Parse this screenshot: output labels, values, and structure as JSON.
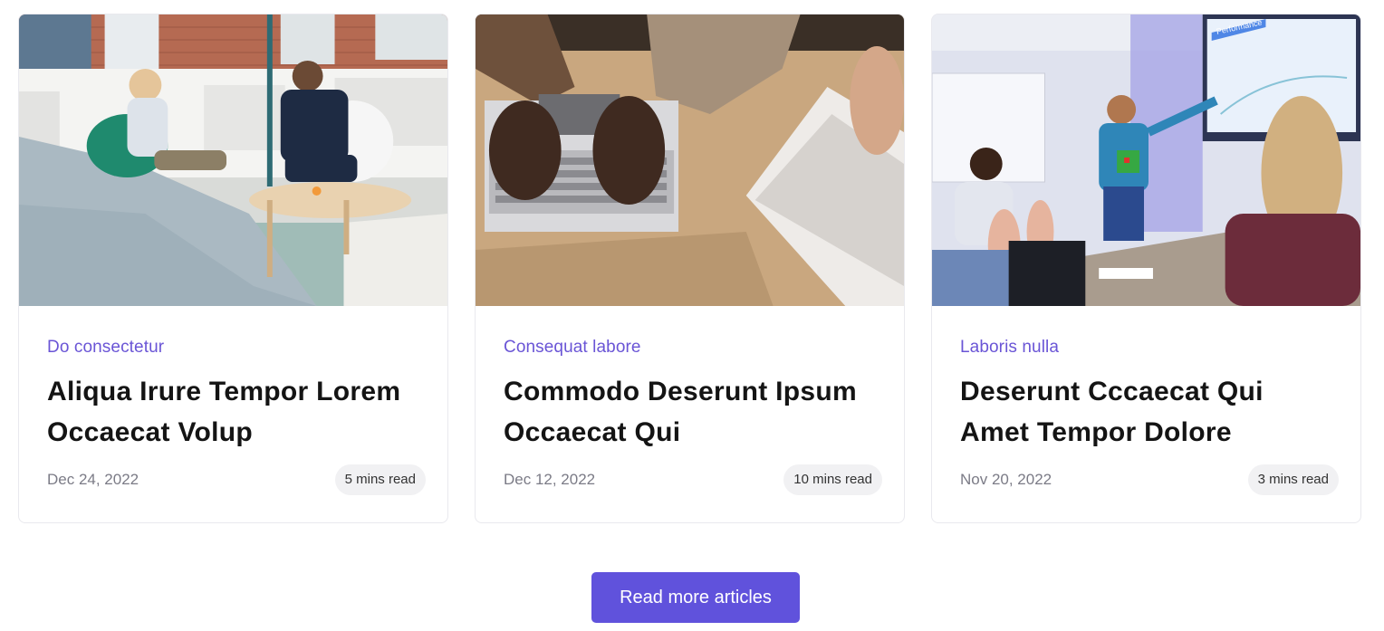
{
  "articles": [
    {
      "category": "Do consectetur",
      "title": "Aliqua Irure Tempor Lorem Occaecat Volup",
      "date": "Dec 24, 2022",
      "read_time": "5 mins read"
    },
    {
      "category": "Consequat labore",
      "title": "Commodo Deserunt Ipsum Occaecat Qui",
      "date": "Dec 12, 2022",
      "read_time": "10 mins read"
    },
    {
      "category": "Laboris nulla",
      "title": "Deserunt Cccaecat Qui Amet Tempor Dolore",
      "date": "Nov 20, 2022",
      "read_time": "3 mins read"
    }
  ],
  "images": [
    {
      "scene": "lounge-meeting"
    },
    {
      "scene": "laptops-desk"
    },
    {
      "scene": "presentation-room",
      "screen_text": "Performance"
    }
  ],
  "cta": {
    "label": "Read more articles"
  },
  "colors": {
    "accent": "#6052dc",
    "category": "#6a55d6",
    "title": "#141414",
    "meta": "#7b7b86"
  }
}
